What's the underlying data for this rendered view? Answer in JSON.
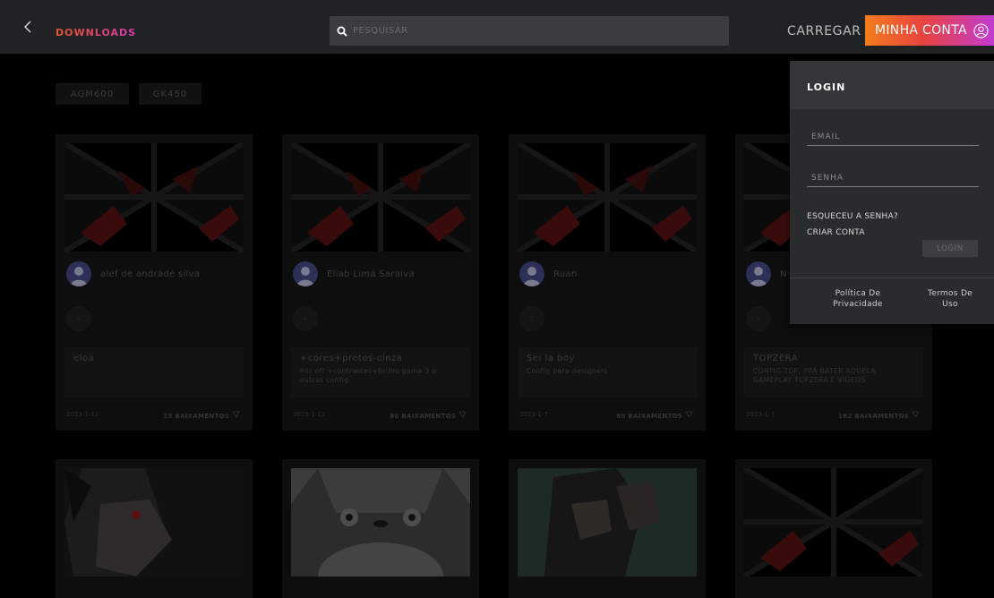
{
  "header": {
    "brand": "DOWNLOADS",
    "search_placeholder": "PESQUISAR",
    "upload_label": "CARREGAR",
    "account_label": "MINHA CONTA"
  },
  "filters": [
    {
      "label": "AGM600"
    },
    {
      "label": "GK450"
    }
  ],
  "cards": [
    {
      "user": "alef de andrade silva",
      "circle": "-",
      "title": "eloa",
      "description": "",
      "date": "2023-1-11",
      "downloads": "15 BAIXAMENTOS"
    },
    {
      "user": "Eliab Lima Saraiva",
      "circle": "-",
      "title": "+cores+pretos-cinza",
      "description": "hdr off +contrastes+brilho gama 3 e outras config",
      "date": "2023-1-11",
      "downloads": "80 BAIXAMENTOS"
    },
    {
      "user": "Ruan",
      "circle": ":",
      "title": "Sei la boy",
      "description": "Config para designers",
      "date": "2023-1-7",
      "downloads": "69 BAIXAMENTOS"
    },
    {
      "user": "N",
      "circle": "-",
      "title": "TOPZERA",
      "description": "CONFIG TOP, PRA BATER AQUELA GAMEPLAY TOPZERA E VIDEOS",
      "date": "2023-1-7",
      "downloads": "162 BAIXAMENTOS"
    }
  ],
  "login": {
    "title": "LOGIN",
    "email_placeholder": "EMAIL",
    "password_placeholder": "SENHA",
    "forgot_password": "ESQUECEU A SENHA?",
    "create_account": "CRIAR CONTA",
    "submit_label": "LOGIN",
    "privacy_line1": "Política De",
    "privacy_line2": "Privacidade",
    "terms_line1": "Termos De",
    "terms_line2": "Uso"
  },
  "colors": {
    "topbar": "#212224",
    "brand_gradient": [
      "#e8542a",
      "#d63ab1"
    ],
    "account_gradient": [
      "#f47c1c",
      "#e8433f",
      "#c23bd2"
    ],
    "login_panel": "#2a2b2d"
  },
  "icons": [
    "back-chevron-icon",
    "search-icon",
    "user-circle-icon",
    "avatar-icon",
    "download-icon"
  ]
}
